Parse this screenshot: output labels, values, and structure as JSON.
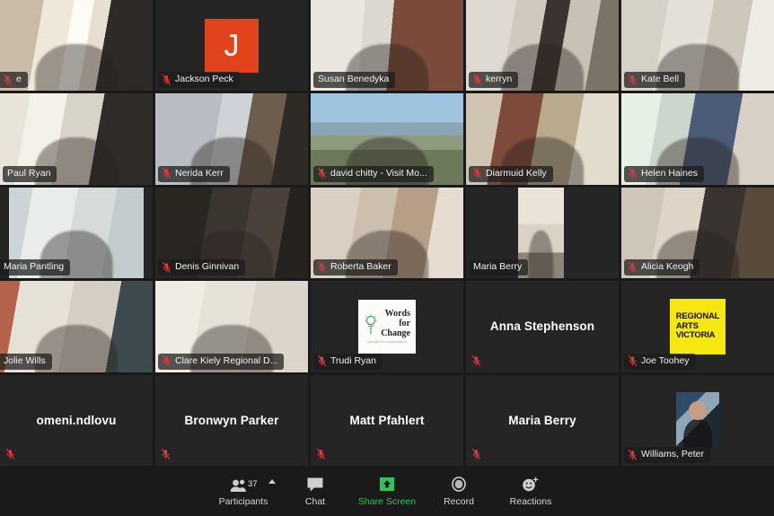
{
  "app": {
    "name": "Zoom",
    "view": "gallery"
  },
  "meeting": {
    "active_speaker": "Susan Benedyka",
    "active_border_color": "#b9e94a",
    "tile_bg": "#252525",
    "window_bg": "#1a1a1a",
    "mute_icon_color": "#e0373a"
  },
  "participants": [
    {
      "id": 1,
      "name": "e",
      "name_clipped": true,
      "video": true,
      "muted": true,
      "active": false,
      "avatar": "none",
      "row": 1,
      "col": 1
    },
    {
      "id": 2,
      "name": "Jackson Peck",
      "name_clipped": false,
      "video": false,
      "muted": true,
      "active": false,
      "avatar": "letter-j",
      "row": 1,
      "col": 2
    },
    {
      "id": 3,
      "name": "Susan Benedyka",
      "name_clipped": false,
      "video": true,
      "muted": false,
      "active": true,
      "avatar": "none",
      "row": 1,
      "col": 3
    },
    {
      "id": 4,
      "name": "kerryn",
      "name_clipped": false,
      "video": true,
      "muted": true,
      "active": false,
      "avatar": "none",
      "row": 1,
      "col": 4
    },
    {
      "id": 5,
      "name": "Kate Bell",
      "name_clipped": false,
      "video": true,
      "muted": true,
      "active": false,
      "avatar": "none",
      "row": 1,
      "col": 5
    },
    {
      "id": 6,
      "name": "Paul Ryan",
      "name_clipped": false,
      "video": true,
      "muted": false,
      "active": false,
      "avatar": "none",
      "row": 2,
      "col": 1
    },
    {
      "id": 7,
      "name": "Nerida Kerr",
      "name_clipped": false,
      "video": true,
      "muted": true,
      "active": false,
      "avatar": "none",
      "row": 2,
      "col": 2
    },
    {
      "id": 8,
      "name": "david chitty - Visit Mo...",
      "name_clipped": false,
      "video": true,
      "muted": true,
      "active": false,
      "avatar": "none",
      "row": 2,
      "col": 3
    },
    {
      "id": 9,
      "name": "Diarmuid Kelly",
      "name_clipped": false,
      "video": true,
      "muted": true,
      "active": false,
      "avatar": "none",
      "row": 2,
      "col": 4
    },
    {
      "id": 10,
      "name": "Helen Haines",
      "name_clipped": false,
      "video": true,
      "muted": true,
      "active": false,
      "avatar": "none",
      "row": 2,
      "col": 5
    },
    {
      "id": 11,
      "name": "Maria Pantling",
      "name_clipped": true,
      "video": true,
      "muted": false,
      "active": false,
      "avatar": "none",
      "row": 3,
      "col": 1
    },
    {
      "id": 12,
      "name": "Denis Ginnivan",
      "name_clipped": false,
      "video": true,
      "muted": true,
      "active": false,
      "avatar": "none",
      "row": 3,
      "col": 2
    },
    {
      "id": 13,
      "name": "Roberta Baker",
      "name_clipped": false,
      "video": true,
      "muted": true,
      "active": false,
      "avatar": "none",
      "row": 3,
      "col": 3
    },
    {
      "id": 14,
      "name": "Maria Berry",
      "name_clipped": false,
      "video": true,
      "muted": false,
      "active": false,
      "avatar": "none",
      "row": 3,
      "col": 4
    },
    {
      "id": 15,
      "name": "Alicia Keogh",
      "name_clipped": false,
      "video": true,
      "muted": true,
      "active": false,
      "avatar": "none",
      "row": 3,
      "col": 5
    },
    {
      "id": 16,
      "name": "Jolie Wills",
      "name_clipped": true,
      "video": true,
      "muted": false,
      "active": false,
      "avatar": "none",
      "row": 4,
      "col": 1
    },
    {
      "id": 17,
      "name": "Clare Kiely Regional D...",
      "name_clipped": false,
      "video": true,
      "muted": true,
      "active": false,
      "avatar": "none",
      "row": 4,
      "col": 2
    },
    {
      "id": 18,
      "name": "Trudi Ryan",
      "name_clipped": false,
      "video": false,
      "muted": true,
      "active": false,
      "avatar": "words-for-change",
      "row": 4,
      "col": 3
    },
    {
      "id": 19,
      "name": "Anna Stephenson",
      "name_clipped": false,
      "video": false,
      "muted": true,
      "active": false,
      "avatar": "name-text",
      "row": 4,
      "col": 4
    },
    {
      "id": 20,
      "name": "Joe Toohey",
      "name_clipped": false,
      "video": false,
      "muted": true,
      "active": false,
      "avatar": "regional-arts-victoria",
      "row": 4,
      "col": 5
    },
    {
      "id": 21,
      "name": "omeni.ndlovu",
      "name_clipped": false,
      "video": false,
      "muted": true,
      "active": false,
      "avatar": "name-text",
      "row": 5,
      "col": 1
    },
    {
      "id": 22,
      "name": "Bronwyn Parker",
      "name_clipped": false,
      "video": false,
      "muted": true,
      "active": false,
      "avatar": "name-text",
      "row": 5,
      "col": 2
    },
    {
      "id": 23,
      "name": "Matt Pfahlert",
      "name_clipped": false,
      "video": false,
      "muted": true,
      "active": false,
      "avatar": "name-text",
      "row": 5,
      "col": 3
    },
    {
      "id": 24,
      "name": "Maria Berry",
      "name_clipped": false,
      "video": false,
      "muted": true,
      "active": false,
      "avatar": "name-text",
      "row": 5,
      "col": 4
    },
    {
      "id": 25,
      "name": "Williams, Peter",
      "name_clipped": false,
      "video": false,
      "muted": true,
      "active": false,
      "avatar": "photo",
      "row": 5,
      "col": 5
    }
  ],
  "avatars": {
    "letter_j": "J",
    "words_for_change": {
      "line1": "Words",
      "line2": "for",
      "line3": "Change",
      "tagline": "change the conversation"
    },
    "regional_arts_victoria": {
      "line1": "REGIONAL",
      "line2": "ARTS",
      "line3": "VICTORIA",
      "bg": "#f7e711"
    }
  },
  "toolbar": {
    "participants": {
      "label": "Participants",
      "count": "37",
      "icon": "people-icon",
      "has_caret": true
    },
    "chat": {
      "label": "Chat",
      "icon": "chat-bubble-icon"
    },
    "share_screen": {
      "label": "Share Screen",
      "icon": "share-screen-icon",
      "color": "#2fc35a"
    },
    "record": {
      "label": "Record",
      "icon": "record-icon"
    },
    "reactions": {
      "label": "Reactions",
      "icon": "reactions-icon"
    }
  }
}
